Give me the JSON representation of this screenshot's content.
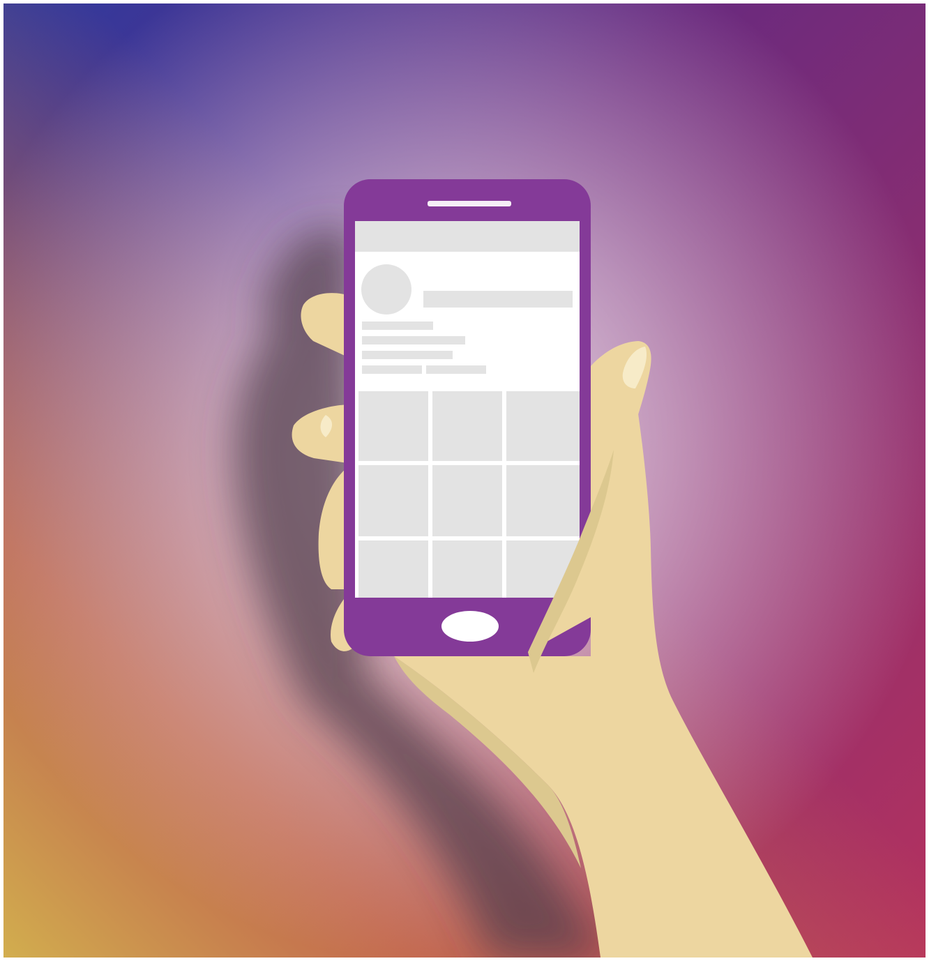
{
  "scene": {
    "subject": "hand-holding-smartphone",
    "screen_layout": "social-profile-grid",
    "grid_columns": 3,
    "grid_rows": 3
  },
  "colors": {
    "gradient_blue": "#2e3a9e",
    "gradient_purple": "#6a2a7e",
    "gradient_magenta": "#b5325e",
    "gradient_orange": "#cc7348",
    "gradient_yellow": "#d2ae4e",
    "glow": "#f3e7ef",
    "phone_body": "#843a98",
    "speaker": "#f5eef6",
    "screen_bg": "#ffffff",
    "placeholder": "#e3e3e3",
    "home_button": "#ffffff",
    "skin": "#edd6a0",
    "skin_shade": "#dcc88f",
    "skin_highlight": "#f7ebc8",
    "shadow": "#4f3a4a"
  }
}
